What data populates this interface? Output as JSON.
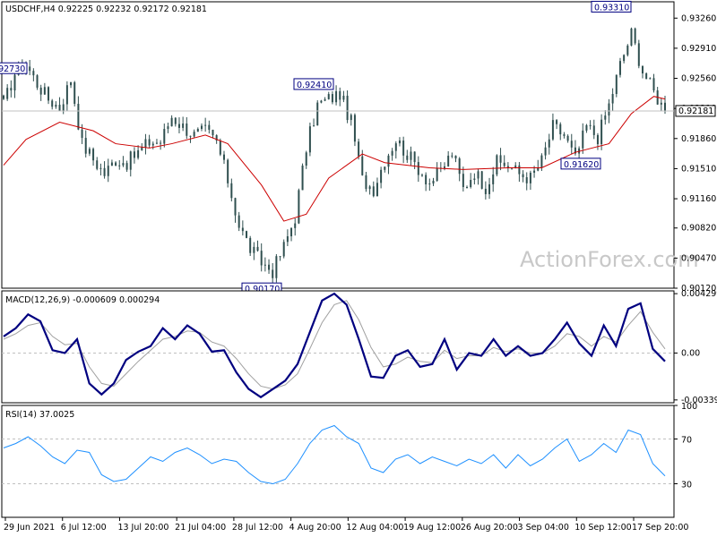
{
  "header": {
    "symbol": "USDCHF,H4",
    "open": "0.92225",
    "high": "0.92232",
    "low": "0.92172",
    "close": "0.92181"
  },
  "watermark": "ActionForex.com",
  "colors": {
    "candles": "#2f4f4f",
    "ma_line": "#cc0000",
    "macd_line": "#000080",
    "signal_line": "#a0a0a0",
    "rsi_line": "#1e90ff",
    "grid": "#c0c0c0",
    "annotation_text": "#000080"
  },
  "chart_data": [
    {
      "type": "candlestick",
      "title": "USDCHF,H4 0.92225 0.92232 0.92172 0.92181",
      "ylim": [
        0.9012,
        0.9345
      ],
      "y_ticks": [
        "0.93260",
        "0.92910",
        "0.92560",
        "0.92210",
        "0.91860",
        "0.91510",
        "0.91160",
        "0.90820",
        "0.90470",
        "0.90120"
      ],
      "current_price_label": "0.92181",
      "current_price": 0.92181,
      "x_tick_labels": [
        "29 Jun 2021",
        "6 Jul 12:00",
        "13 Jul 20:00",
        "21 Jul 04:00",
        "28 Jul 12:00",
        "4 Aug 20:00",
        "12 Aug 04:00",
        "19 Aug 12:00",
        "26 Aug 20:00",
        "3 Sep 04:00",
        "10 Sep 12:00",
        "17 Sep 20:00"
      ],
      "annotations": [
        {
          "label": "0.92730",
          "value": 0.9273
        },
        {
          "label": "0.92410",
          "value": 0.9241
        },
        {
          "label": "0.90170",
          "value": 0.9017
        },
        {
          "label": "0.91620",
          "value": 0.9162
        },
        {
          "label": "0.93310",
          "value": 0.9331
        }
      ],
      "close_path": [
        [
          "29 Jun",
          0.9225
        ],
        [
          "30 Jun",
          0.9262
        ],
        [
          "1 Jul",
          0.9272
        ],
        [
          "2 Jul",
          0.925
        ],
        [
          "5 Jul",
          0.9232
        ],
        [
          "6 Jul",
          0.9222
        ],
        [
          "7 Jul",
          0.9255
        ],
        [
          "8 Jul",
          0.918
        ],
        [
          "9 Jul",
          0.9162
        ],
        [
          "12 Jul",
          0.9145
        ],
        [
          "13 Jul",
          0.9162
        ],
        [
          "14 Jul",
          0.9158
        ],
        [
          "15 Jul",
          0.917
        ],
        [
          "16 Jul",
          0.9182
        ],
        [
          "19 Jul",
          0.9182
        ],
        [
          "20 Jul",
          0.9212
        ],
        [
          "21 Jul",
          0.92
        ],
        [
          "22 Jul",
          0.919
        ],
        [
          "23 Jul",
          0.9195
        ],
        [
          "26 Jul",
          0.9182
        ],
        [
          "27 Jul",
          0.9138
        ],
        [
          "28 Jul",
          0.9085
        ],
        [
          "29 Jul",
          0.9058
        ],
        [
          "30 Jul",
          0.9042
        ],
        [
          "2 Aug",
          0.9032
        ],
        [
          "3 Aug",
          0.906
        ],
        [
          "4 Aug",
          0.9095
        ],
        [
          "5 Aug",
          0.9175
        ],
        [
          "6 Aug",
          0.9225
        ],
        [
          "9 Aug",
          0.9232
        ],
        [
          "10 Aug",
          0.9238
        ],
        [
          "11 Aug",
          0.9205
        ],
        [
          "12 Aug",
          0.9138
        ],
        [
          "13 Aug",
          0.9128
        ],
        [
          "16 Aug",
          0.9162
        ],
        [
          "17 Aug",
          0.9185
        ],
        [
          "18 Aug",
          0.9168
        ],
        [
          "19 Aug",
          0.9152
        ],
        [
          "20 Aug",
          0.9135
        ],
        [
          "23 Aug",
          0.9148
        ],
        [
          "24 Aug",
          0.917
        ],
        [
          "25 Aug",
          0.9128
        ],
        [
          "26 Aug",
          0.9148
        ],
        [
          "27 Aug",
          0.913
        ],
        [
          "30 Aug",
          0.9158
        ],
        [
          "31 Aug",
          0.9155
        ],
        [
          "1 Sep",
          0.9145
        ],
        [
          "2 Sep",
          0.914
        ],
        [
          "3 Sep",
          0.916
        ],
        [
          "6 Sep",
          0.92
        ],
        [
          "7 Sep",
          0.919
        ],
        [
          "8 Sep",
          0.9162
        ],
        [
          "9 Sep",
          0.92
        ],
        [
          "10 Sep",
          0.9188
        ],
        [
          "13 Sep",
          0.9225
        ],
        [
          "14 Sep",
          0.9272
        ],
        [
          "15 Sep",
          0.9308
        ],
        [
          "16 Sep",
          0.9265
        ],
        [
          "17 Sep",
          0.924
        ],
        [
          "20 Sep",
          0.9218
        ]
      ],
      "moving_average": [
        [
          "29 Jun",
          0.9155
        ],
        [
          "1 Jul",
          0.9185
        ],
        [
          "6 Jul",
          0.9205
        ],
        [
          "9 Jul",
          0.9195
        ],
        [
          "13 Jul",
          0.918
        ],
        [
          "16 Jul",
          0.9175
        ],
        [
          "20 Jul",
          0.918
        ],
        [
          "23 Jul",
          0.919
        ],
        [
          "27 Jul",
          0.918
        ],
        [
          "30 Jul",
          0.9132
        ],
        [
          "3 Aug",
          0.909
        ],
        [
          "5 Aug",
          0.9098
        ],
        [
          "9 Aug",
          0.914
        ],
        [
          "12 Aug",
          0.9168
        ],
        [
          "16 Aug",
          0.9158
        ],
        [
          "20 Aug",
          0.9152
        ],
        [
          "25 Aug",
          0.915
        ],
        [
          "31 Aug",
          0.9152
        ],
        [
          "3 Sep",
          0.9152
        ],
        [
          "8 Sep",
          0.917
        ],
        [
          "13 Sep",
          0.918
        ],
        [
          "15 Sep",
          0.9215
        ],
        [
          "17 Sep",
          0.9235
        ],
        [
          "20 Sep",
          0.9232
        ]
      ]
    },
    {
      "type": "line",
      "title": "MACD(12,26,9) -0.000609 0.000294",
      "ylim": [
        -0.0036,
        0.0045
      ],
      "y_ticks": [
        "0.004299",
        "0.00",
        "-0.003396"
      ],
      "series": [
        {
          "name": "MACD",
          "values": [
            0.0012,
            0.0018,
            0.0028,
            0.0023,
            0.0002,
            0.0,
            0.001,
            -0.0022,
            -0.003,
            -0.0022,
            -0.0005,
            0.0001,
            0.0005,
            0.0018,
            0.001,
            0.002,
            0.0014,
            0.0001,
            0.0002,
            -0.0014,
            -0.0026,
            -0.0032,
            -0.0026,
            -0.002,
            -0.0008,
            0.0015,
            0.0038,
            0.0043,
            0.0035,
            0.001,
            -0.0017,
            -0.0018,
            -0.0002,
            0.0002,
            -0.001,
            -0.0008,
            0.001,
            -0.0012,
            0.0,
            -0.0002,
            0.001,
            -0.0002,
            0.0005,
            -0.0002,
            0.0,
            0.001,
            0.0022,
            0.0007,
            -0.0002,
            0.002,
            0.0005,
            0.0032,
            0.0036,
            0.0003,
            -0.0006
          ]
        },
        {
          "name": "Signal",
          "values": [
            0.001,
            0.0014,
            0.002,
            0.0022,
            0.0012,
            0.0006,
            0.0007,
            -0.001,
            -0.0022,
            -0.0024,
            -0.0015,
            -0.0006,
            0.0002,
            0.001,
            0.0012,
            0.0016,
            0.0015,
            0.0008,
            0.0005,
            -0.0004,
            -0.0015,
            -0.0024,
            -0.0026,
            -0.0023,
            -0.0015,
            0.0003,
            0.0022,
            0.0035,
            0.0038,
            0.0024,
            0.0004,
            -0.001,
            -0.0008,
            -0.0003,
            -0.0006,
            -0.0007,
            0.0002,
            -0.0004,
            -0.0002,
            -0.0002,
            0.0004,
            0.0001,
            0.0003,
            0.0,
            0.0,
            0.0005,
            0.0014,
            0.0012,
            0.0005,
            0.0012,
            0.0008,
            0.002,
            0.003,
            0.0015,
            0.0003
          ]
        }
      ]
    },
    {
      "type": "line",
      "title": "RSI(14) 37.0025",
      "ylim": [
        0,
        100
      ],
      "y_ticks": [
        "100",
        "70",
        "30",
        "0"
      ],
      "levels": [
        70,
        30
      ],
      "series": [
        {
          "name": "RSI",
          "values": [
            62,
            66,
            72,
            64,
            54,
            48,
            60,
            58,
            38,
            32,
            34,
            44,
            54,
            50,
            58,
            62,
            56,
            48,
            52,
            50,
            40,
            32,
            30,
            34,
            48,
            66,
            78,
            82,
            72,
            66,
            44,
            40,
            52,
            56,
            48,
            54,
            50,
            46,
            52,
            48,
            56,
            44,
            56,
            46,
            52,
            62,
            70,
            50,
            56,
            66,
            58,
            78,
            74,
            48,
            37
          ]
        }
      ]
    }
  ]
}
